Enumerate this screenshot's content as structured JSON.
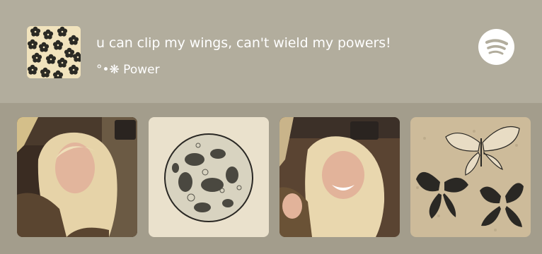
{
  "now_playing": {
    "title": "u can clip my wings, can't wield my powers!",
    "subtitle": "°•❋ Power",
    "album_art_icon": "flower-pattern-album-art",
    "brand_icon": "spotify-icon"
  },
  "gallery": [
    {
      "icon": "photo-woman-in-car"
    },
    {
      "icon": "moon-illustration"
    },
    {
      "icon": "photo-woman-laughing"
    },
    {
      "icon": "butterflies-illustration"
    }
  ],
  "colors": {
    "background": "#a39d8c",
    "header": "#b2ad9d",
    "text": "#ffffff"
  }
}
